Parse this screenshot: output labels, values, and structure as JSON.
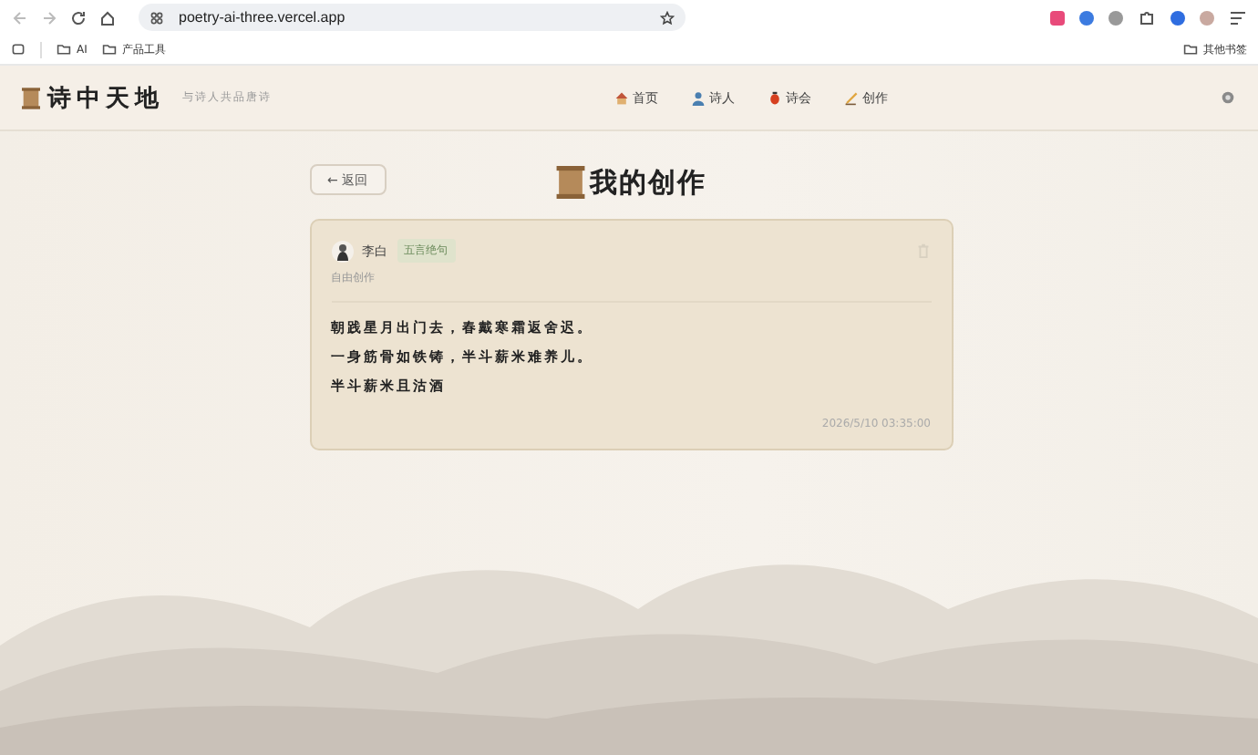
{
  "browser": {
    "url": "poetry-ai-three.vercel.app",
    "bookmarks": [
      {
        "label": "AI"
      },
      {
        "label": "产品工具"
      }
    ],
    "other_bookmarks": "其他书签"
  },
  "header": {
    "logo": "诗中天地",
    "tagline": "与诗人共品唐诗",
    "nav": [
      {
        "kind": "home",
        "label": "首页"
      },
      {
        "kind": "poets",
        "label": "诗人"
      },
      {
        "kind": "salon",
        "label": "诗会"
      },
      {
        "kind": "compose",
        "label": "创作"
      }
    ]
  },
  "back_button": "← 返回",
  "page_title": "我的创作",
  "works": [
    {
      "poet": "李白",
      "form": "五言绝句",
      "source": "自由创作",
      "lines": [
        "朝践星月出门去，春戴寒霜返舍迟。",
        "一身筋骨如铁铸，半斗薪米难养儿。",
        "半斗薪米且沽酒"
      ],
      "time": "2026/5/10 03:35:00"
    }
  ]
}
